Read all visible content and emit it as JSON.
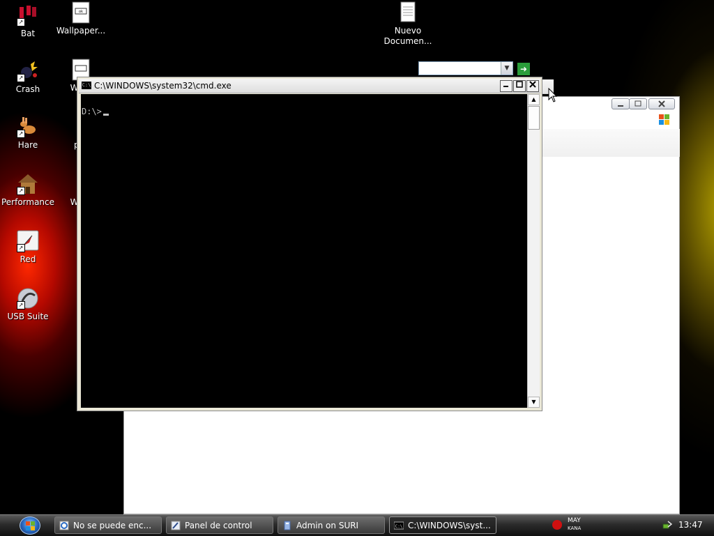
{
  "desktop": {
    "icons": [
      {
        "label": "Bat",
        "icon": "bat-shortcut-icon"
      },
      {
        "label": "Wallpaper...",
        "icon": "wallpaper-file-icon"
      },
      {
        "label": "Nuevo\nDocumen...",
        "icon": "text-document-icon"
      },
      {
        "label": "Crash",
        "icon": "crash-shortcut-icon"
      },
      {
        "label": "WinX",
        "icon": "winx-file-icon"
      },
      {
        "label": "Hare",
        "icon": "hare-shortcut-icon"
      },
      {
        "label": "per",
        "icon": "per-file-icon"
      },
      {
        "label": "Performance",
        "icon": "performance-shortcut-icon"
      },
      {
        "label": "WinX",
        "icon": "winx-file-icon"
      },
      {
        "label": "Red",
        "icon": "red-shortcut-icon"
      },
      {
        "label": "USB Suite",
        "icon": "usb-suite-shortcut-icon"
      }
    ]
  },
  "console": {
    "title": "C:\\WINDOWS\\system32\\cmd.exe",
    "icon_text": "C:\\",
    "prompt": "D:\\>",
    "minimize": "_",
    "maximize": "□",
    "close": "×",
    "scroll_up": "▲",
    "scroll_down": "▼"
  },
  "explorer": {
    "go_label": "Ir",
    "dropdown_arrow": "▼"
  },
  "taskbar": {
    "tasks": [
      {
        "label": "No se puede enc...",
        "icon": "internet-explorer-icon",
        "active": false
      },
      {
        "label": "Panel de control",
        "icon": "control-panel-icon",
        "active": false
      },
      {
        "label": "Admin on SURI",
        "icon": "remote-admin-icon",
        "active": false
      },
      {
        "label": "C:\\WINDOWS\\syst...",
        "icon": "cmd-icon",
        "active": true
      }
    ],
    "tray": {
      "caps": "MAY",
      "kana": "KANA",
      "clock": "13:47"
    }
  },
  "colors": {
    "console_bg": "#000000",
    "console_text": "#c0c0c0",
    "desktop_glow_red": "#ff2800",
    "desktop_glow_yellow": "#bea000"
  }
}
